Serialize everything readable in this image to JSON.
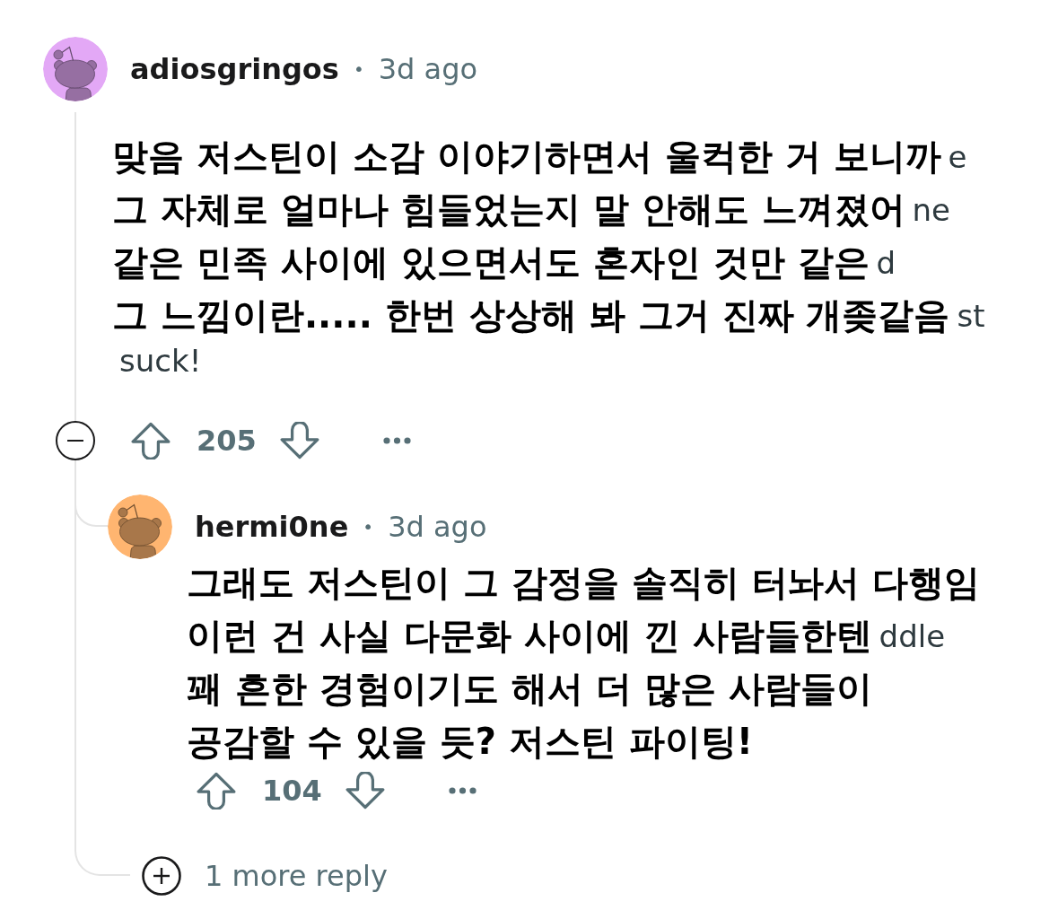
{
  "thread": {
    "author": "adiosgringos",
    "separator": "•",
    "time": "3d ago",
    "avatar": {
      "color": "#e3a8f6"
    },
    "body": [
      {
        "text": "맞음 저스틴이 소감 이야기하면서 울컥한 거 보니까",
        "tail": "e"
      },
      {
        "text": "그 자체로 얼마나 힘들었는지 말 안해도 느껴졌어",
        "tail": "ne"
      },
      {
        "text": "같은 민족 사이에 있으면서도 혼자인 것만 같은",
        "tail": "d"
      },
      {
        "text": "그 느낌이란..... 한번 상상해 봐 그거 진짜 개좆같음",
        "tail": "st"
      }
    ],
    "after_text": "suck!",
    "expanded": true,
    "score": "205",
    "replies": [
      {
        "author": "hermi0ne",
        "separator": "•",
        "time": "3d ago",
        "avatar": {
          "color": "#ffb570"
        },
        "body": [
          {
            "text": "그래도 저스틴이 그 감정을 솔직히 터놔서 다행임"
          },
          {
            "text": "이런 건 사실 다문화 사이에 낀 사람들한텐",
            "tail": "ddle"
          },
          {
            "text": "꽤 흔한 경험이기도 해서 더 많은 사람들이"
          },
          {
            "text": "공감할 수 있을 듯? 저스틴 파이팅!"
          }
        ],
        "score": "104"
      }
    ],
    "more_replies": "1 more reply"
  }
}
